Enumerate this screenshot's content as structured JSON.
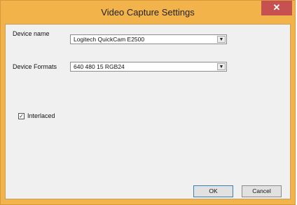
{
  "window": {
    "title": "Video Capture Settings",
    "close_glyph": "✕"
  },
  "form": {
    "device_name_label": "Device name",
    "device_name_value": "Logitech QuickCam E2500",
    "device_formats_label": "Device Formats",
    "device_formats_value": "640 480 15 RGB24",
    "interlaced_label": "Interlaced",
    "interlaced_checked": true,
    "check_glyph": "✓",
    "dropdown_glyph": "▼"
  },
  "buttons": {
    "ok_label": "OK",
    "cancel_label": "Cancel"
  },
  "colors": {
    "title_bar": "#f3b34b",
    "close_button": "#c75050",
    "client_background": "#f0f0f0"
  }
}
